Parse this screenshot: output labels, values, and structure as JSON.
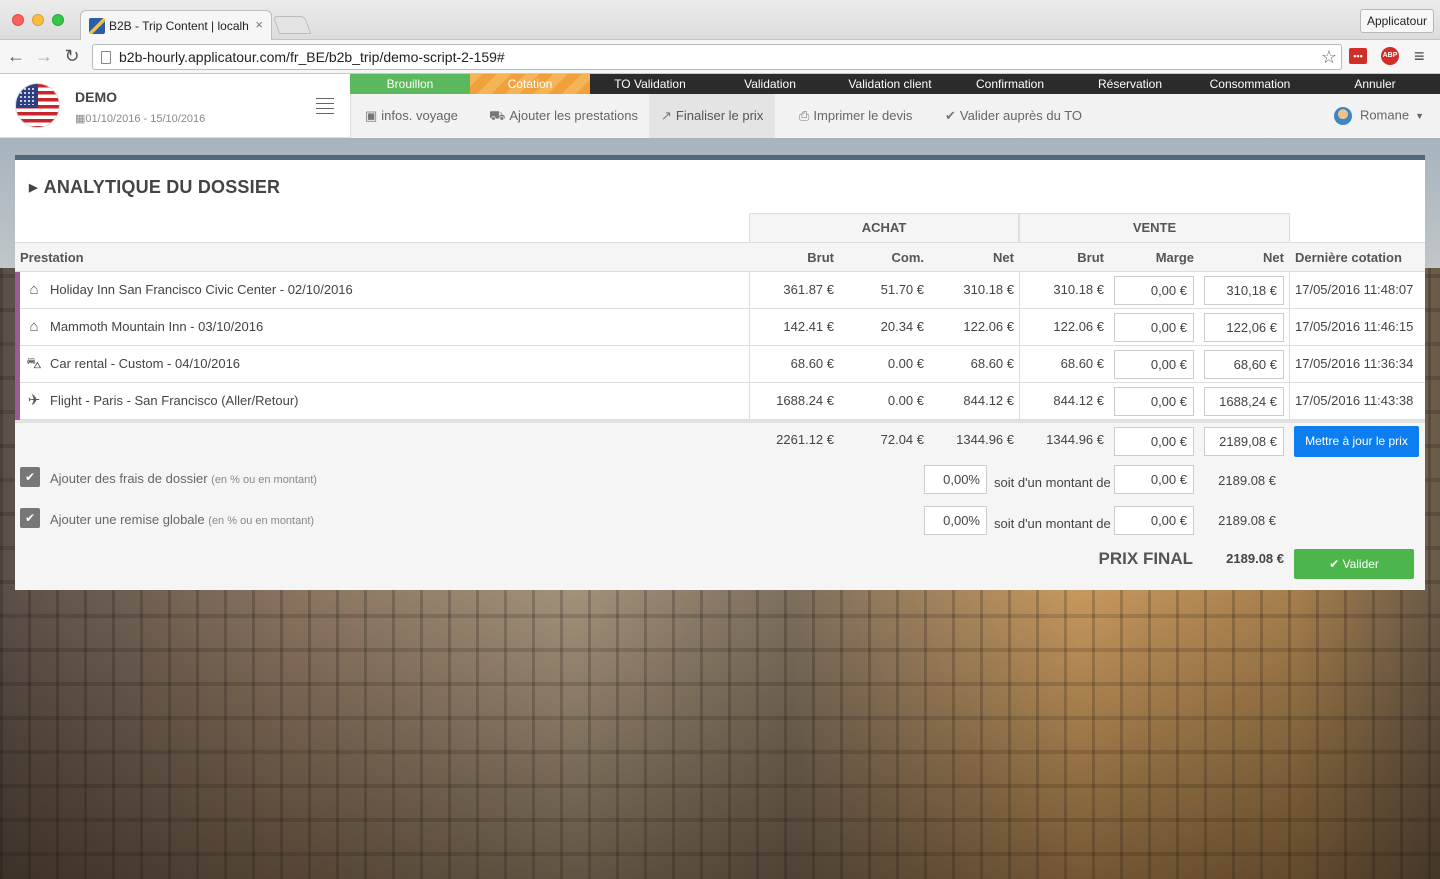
{
  "browser": {
    "tab_title": "B2B - Trip Content | localh",
    "tab_close": "×",
    "url": "b2b-hourly.applicatour.com/fr_BE/b2b_trip/demo-script-2-159#",
    "profile": "Applicatour",
    "ext_lastpass": "•••",
    "ext_abp": "ABP"
  },
  "trip": {
    "name": "DEMO",
    "dates": "01/10/2016 - 15/10/2016"
  },
  "status_steps": [
    "Brouillon",
    "Cotation",
    "TO Validation",
    "Validation",
    "Validation client",
    "Confirmation",
    "Réservation",
    "Consommation",
    "Annuler"
  ],
  "actions": {
    "infos": "infos. voyage",
    "add": "Ajouter les prestations",
    "finalize": "Finaliser le prix",
    "print": "Imprimer le devis",
    "validate_to": "Valider auprès du TO"
  },
  "user": {
    "name": "Romane"
  },
  "panel": {
    "title": "ANALYTIQUE DU DOSSIER",
    "group_achat": "ACHAT",
    "group_vente": "VENTE",
    "columns": {
      "prestation": "Prestation",
      "brut": "Brut",
      "com": "Com.",
      "net": "Net",
      "vbrut": "Brut",
      "marge": "Marge",
      "vnet": "Net",
      "derniere": "Dernière cotation"
    },
    "rows": [
      {
        "icon": "home-icon",
        "name": "Holiday Inn San Francisco Civic Center - 02/10/2016",
        "brut": "361.87 €",
        "com": "51.70 €",
        "net": "310.18 €",
        "vbrut": "310.18 €",
        "marge": "0,00 €",
        "vnet": "310,18 €",
        "date": "17/05/2016 11:48:07"
      },
      {
        "icon": "home-icon",
        "name": "Mammoth Mountain Inn - 03/10/2016",
        "brut": "142.41 €",
        "com": "20.34 €",
        "net": "122.06 €",
        "vbrut": "122.06 €",
        "marge": "0,00 €",
        "vnet": "122,06 €",
        "date": "17/05/2016 11:46:15"
      },
      {
        "icon": "car-icon",
        "name": "Car rental - Custom - 04/10/2016",
        "brut": "68.60 €",
        "com": "0.00 €",
        "net": "68.60 €",
        "vbrut": "68.60 €",
        "marge": "0,00 €",
        "vnet": "68,60 €",
        "date": "17/05/2016 11:36:34"
      },
      {
        "icon": "plane-icon",
        "name": "Flight - Paris - San Francisco (Aller/Retour)",
        "brut": "1688.24 €",
        "com": "0.00 €",
        "net": "844.12 €",
        "vbrut": "844.12 €",
        "marge": "0,00 €",
        "vnet": "1688,24 €",
        "date": "17/05/2016 11:43:38"
      }
    ],
    "totals": {
      "brut": "2261.12 €",
      "com": "72.04 €",
      "net": "1344.96 €",
      "vbrut": "1344.96 €",
      "marge": "0,00 €",
      "vnet": "2189,08 €"
    },
    "update_button": "Mettre à jour le prix",
    "fees": {
      "label": "Ajouter des frais de dossier",
      "hint": "(en % ou en montant)",
      "percent": "0,00%",
      "text": "soit d'un montant de",
      "amount": "0,00 €",
      "result": "2189.08 €"
    },
    "discount": {
      "label": "Ajouter une remise globale",
      "hint": "(en % ou en montant)",
      "percent": "0,00%",
      "text": "soit d'un montant de",
      "amount": "0,00 €",
      "result": "2189.08 €"
    },
    "final_label": "PRIX FINAL",
    "final_value": "2189.08 €",
    "validate_button": "Valider"
  },
  "colors": {
    "status_done": "#5cb85c",
    "status_current": "#f0a13b",
    "row_bar": "#9b5a94",
    "primary_button": "#0d7ef0",
    "success_button": "#4cb64c",
    "panel_border": "#51687a"
  }
}
